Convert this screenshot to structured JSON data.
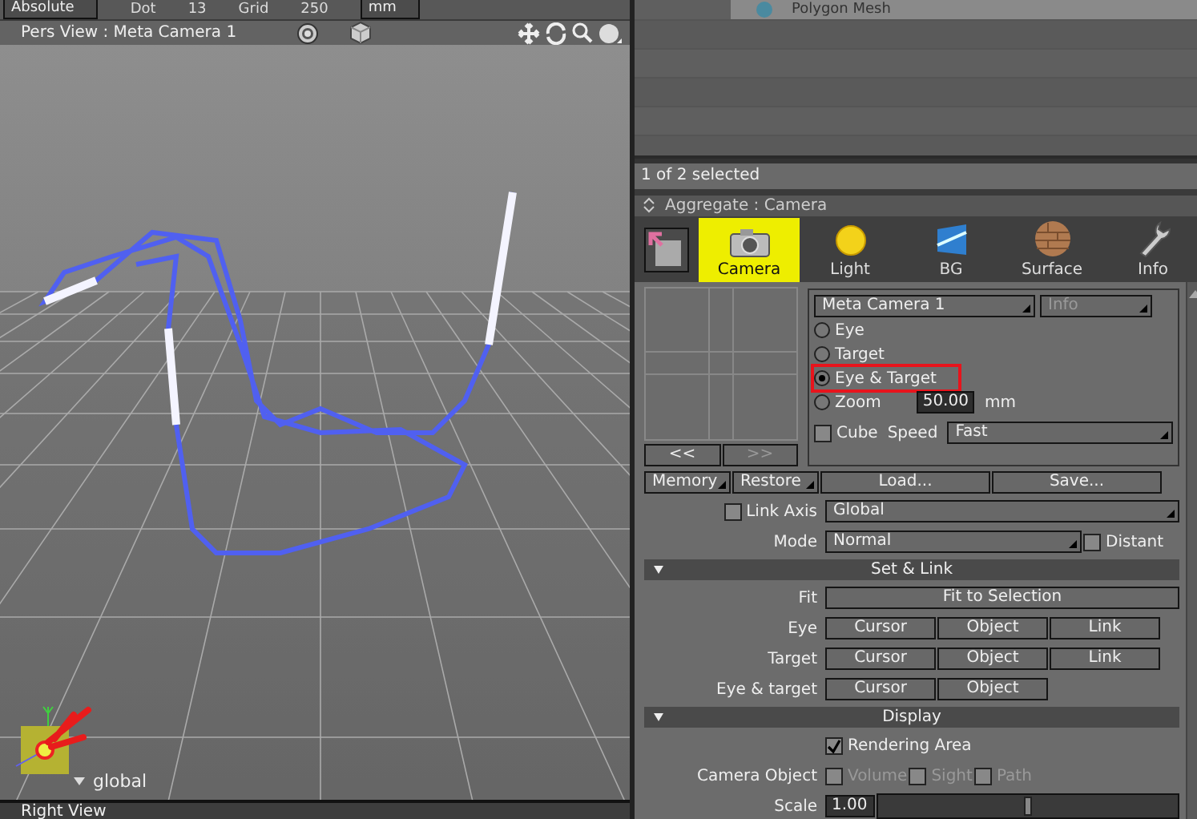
{
  "top_toolbar": {
    "coord_mode": "Absolute",
    "dot_label": "Dot",
    "dot_value": "13",
    "grid_label": "Grid",
    "grid_value": "250",
    "unit": "mm"
  },
  "viewport": {
    "title": "Pers View : Meta Camera 1",
    "axis_label": "global"
  },
  "bottom_view": {
    "title": "Right View"
  },
  "object_list": {
    "items": [
      {
        "name": "Polygon Mesh"
      }
    ],
    "status": "1 of 2 selected"
  },
  "panel": {
    "title": "Aggregate : Camera",
    "tabs": [
      {
        "label": "Camera",
        "selected": true
      },
      {
        "label": "Light",
        "selected": false
      },
      {
        "label": "BG",
        "selected": false
      },
      {
        "label": "Surface",
        "selected": false
      },
      {
        "label": "Info",
        "selected": false
      }
    ],
    "nav_buttons": [
      {
        "label": "<<",
        "disabled": false
      },
      {
        "label": ">>",
        "disabled": true
      }
    ],
    "camera_select": "Meta Camera 1",
    "info_button": {
      "label": "Info",
      "disabled": true
    },
    "modes": [
      {
        "label": "Eye",
        "selected": false,
        "highlighted": false
      },
      {
        "label": "Target",
        "selected": false,
        "highlighted": false
      },
      {
        "label": "Eye & Target",
        "selected": true,
        "highlighted": true
      },
      {
        "label": "Zoom",
        "selected": false,
        "highlighted": false
      }
    ],
    "zoom_value": "50.00",
    "zoom_unit": "mm",
    "cube": {
      "label": "Cube",
      "checked": false
    },
    "speed_label": "Speed",
    "speed": "Fast",
    "memory": "Memory",
    "restore": "Restore",
    "load": "Load...",
    "save": "Save...",
    "link_axis": {
      "label": "Link Axis",
      "checked": false
    },
    "link_axis_value": "Global",
    "mode_label": "Mode",
    "mode_value": "Normal",
    "distant": {
      "label": "Distant",
      "checked": false
    },
    "set_link": {
      "title": "Set & Link",
      "expanded": true,
      "rows": [
        {
          "label": "Fit",
          "buttons": [
            "Fit to Selection"
          ]
        },
        {
          "label": "Eye",
          "buttons": [
            "Cursor",
            "Object",
            "Link"
          ]
        },
        {
          "label": "Target",
          "buttons": [
            "Cursor",
            "Object",
            "Link"
          ]
        },
        {
          "label": "Eye & target",
          "buttons": [
            "Cursor",
            "Object"
          ]
        }
      ]
    },
    "display": {
      "title": "Display",
      "expanded": true,
      "rendering_area": {
        "label": "Rendering Area",
        "checked": true
      },
      "camera_object_label": "Camera Object",
      "camera_object_options": [
        {
          "label": "Volume",
          "checked": false,
          "disabled": true
        },
        {
          "label": "Sight",
          "checked": false,
          "disabled": true
        },
        {
          "label": "Path",
          "checked": false,
          "disabled": true
        }
      ],
      "scale_label": "Scale",
      "scale_value": "1.00",
      "scale": {
        "level": 0.5
      }
    }
  }
}
